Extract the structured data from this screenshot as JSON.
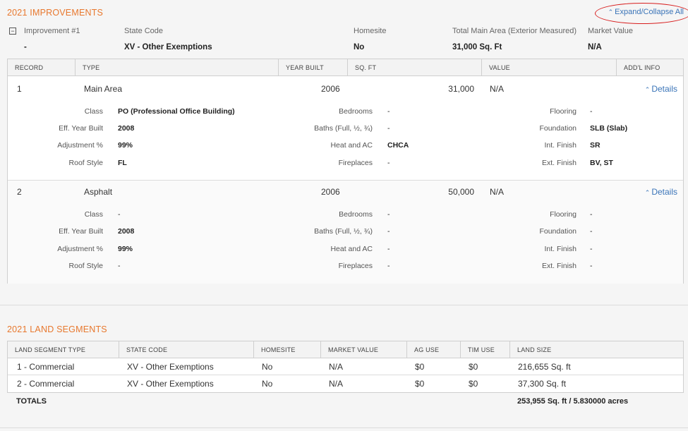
{
  "improvements": {
    "title": "2021 IMPROVEMENTS",
    "expand_label": "Expand/Collapse All",
    "summary": {
      "labels": [
        "Improvement #1",
        "State Code",
        "Homesite",
        "Total Main Area (Exterior Measured)",
        "Market Value"
      ],
      "values": [
        "-",
        "XV - Other Exemptions",
        "No",
        "31,000 Sq. Ft",
        "N/A"
      ]
    },
    "columns": [
      "RECORD",
      "TYPE",
      "YEAR BUILT",
      "SQ. FT",
      "VALUE",
      "ADD'L INFO"
    ],
    "details_label": "Details",
    "records": [
      {
        "record": "1",
        "type": "Main Area",
        "year_built": "2006",
        "sqft": "31,000",
        "value": "N/A",
        "details": {
          "class_label": "Class",
          "class": "PO (Professional Office Building)",
          "eff_label": "Eff. Year Built",
          "eff": "2008",
          "adj_label": "Adjustment %",
          "adj": "99%",
          "roof_label": "Roof Style",
          "roof": "FL",
          "bed_label": "Bedrooms",
          "bed": "-",
          "bath_label": "Baths (Full, ½, ¾)",
          "bath": "-",
          "heat_label": "Heat and AC",
          "heat": "CHCA",
          "fire_label": "Fireplaces",
          "fire": "-",
          "floor_label": "Flooring",
          "floor": "-",
          "found_label": "Foundation",
          "found": "SLB (Slab)",
          "int_label": "Int. Finish",
          "int": "SR",
          "ext_label": "Ext. Finish",
          "ext": "BV, ST"
        }
      },
      {
        "record": "2",
        "type": "Asphalt",
        "year_built": "2006",
        "sqft": "50,000",
        "value": "N/A",
        "details": {
          "class_label": "Class",
          "class": "-",
          "eff_label": "Eff. Year Built",
          "eff": "2008",
          "adj_label": "Adjustment %",
          "adj": "99%",
          "roof_label": "Roof Style",
          "roof": "-",
          "bed_label": "Bedrooms",
          "bed": "-",
          "bath_label": "Baths (Full, ½, ¾)",
          "bath": "-",
          "heat_label": "Heat and AC",
          "heat": "-",
          "fire_label": "Fireplaces",
          "fire": "-",
          "floor_label": "Flooring",
          "floor": "-",
          "found_label": "Foundation",
          "found": "-",
          "int_label": "Int. Finish",
          "int": "-",
          "ext_label": "Ext. Finish",
          "ext": "-"
        }
      }
    ]
  },
  "land": {
    "title": "2021 LAND SEGMENTS",
    "columns": [
      "LAND SEGMENT TYPE",
      "STATE CODE",
      "HOMESITE",
      "MARKET VALUE",
      "AG USE",
      "TIM USE",
      "LAND SIZE"
    ],
    "rows": [
      [
        "1 - Commercial",
        "XV - Other Exemptions",
        "No",
        "N/A",
        "$0",
        "$0",
        "216,655 Sq. ft"
      ],
      [
        "2 - Commercial",
        "XV - Other Exemptions",
        "No",
        "N/A",
        "$0",
        "$0",
        "37,300 Sq. ft"
      ]
    ],
    "totals_label": "TOTALS",
    "totals_value": "253,955 Sq. ft / 5.830000 acres"
  },
  "colors": {
    "accent": "#e8782e",
    "link": "#3a74b8",
    "annotation": "#d81e1e"
  }
}
